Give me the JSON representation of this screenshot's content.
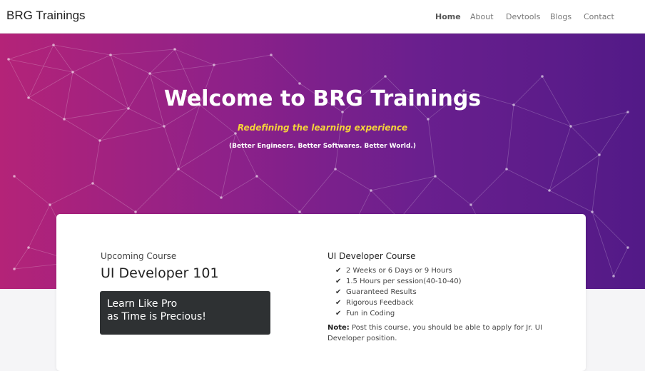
{
  "navbar": {
    "brand": "BRG Trainings",
    "links": [
      {
        "label": "Home",
        "active": true
      },
      {
        "label": "About",
        "active": false
      },
      {
        "label": "Devtools",
        "active": false
      },
      {
        "label": "Blogs",
        "active": false
      },
      {
        "label": "Contact",
        "active": false
      }
    ]
  },
  "hero": {
    "title": "Welcome to BRG Trainings",
    "tagline": "Redefining the learning experience",
    "motto": "(Better Engineers. Better Softwares. Better World.)",
    "gradient_colors": [
      "#b42378",
      "#8e2189",
      "#6a1f8e",
      "#521a87"
    ],
    "tagline_color": "#f5d33a"
  },
  "course_card": {
    "upcoming_label": "Upcoming Course",
    "course_name": "UI Developer 101",
    "promo_line1": "Learn Like Pro",
    "promo_line2": "as Time is Precious!",
    "details_title": "UI Developer Course",
    "features": [
      "2 Weeks or 6 Days or 9 Hours",
      "1.5 Hours per session(40-10-40)",
      "Guaranteed Results",
      "Rigorous Feedback",
      "Fun in Coding"
    ],
    "check_icon": "check-icon",
    "note_label": "Note:",
    "note_text": "Post this course, you should be able to apply for Jr. UI Developer position."
  }
}
